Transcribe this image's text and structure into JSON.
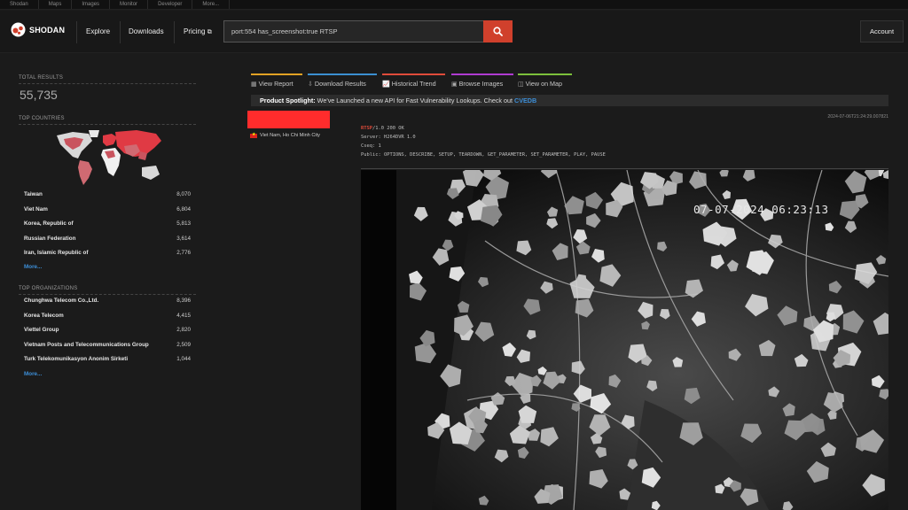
{
  "topbar": {
    "links": [
      "Shodan",
      "Maps",
      "Images",
      "Monitor",
      "Developer",
      "More..."
    ]
  },
  "nav": {
    "logo": "SHODAN",
    "explore": "Explore",
    "downloads": "Downloads",
    "pricing": "Pricing",
    "search_value": "port:554 has_screenshot:true RTSP",
    "account": "Account"
  },
  "sidebar": {
    "total_label": "TOTAL RESULTS",
    "total_value": "55,735",
    "countries_label": "TOP COUNTRIES",
    "countries": [
      {
        "name": "Taiwan",
        "count": "8,070"
      },
      {
        "name": "Viet Nam",
        "count": "6,804"
      },
      {
        "name": "Korea, Republic of",
        "count": "5,813"
      },
      {
        "name": "Russian Federation",
        "count": "3,614"
      },
      {
        "name": "Iran, Islamic Republic of",
        "count": "2,776"
      }
    ],
    "countries_more": "More...",
    "orgs_label": "TOP ORGANIZATIONS",
    "orgs": [
      {
        "name": "Chunghwa Telecom Co.,Ltd.",
        "count": "8,396"
      },
      {
        "name": "Korea Telecom",
        "count": "4,415"
      },
      {
        "name": "Viettel Group",
        "count": "2,820"
      },
      {
        "name": "Vietnam Posts and Telecommunications Group",
        "count": "2,509"
      },
      {
        "name": "Turk Telekomunikasyon Anonim Sirketi",
        "count": "1,044"
      }
    ],
    "orgs_more": "More..."
  },
  "tabs": [
    {
      "label": "View Report",
      "color": "#e2a224"
    },
    {
      "label": "Download Results",
      "color": "#3b8fd1"
    },
    {
      "label": "Historical Trend",
      "color": "#e04b3a"
    },
    {
      "label": "Browse Images",
      "color": "#b03bd1"
    },
    {
      "label": "View on Map",
      "color": "#7cc13b"
    }
  ],
  "spotlight": {
    "title": "Product Spotlight:",
    "text": " We've Launched a new API for Fast Vulnerability Lookups. Check out ",
    "link": "CVEDB"
  },
  "result": {
    "location": "Viet Nam, Ho Chi Minh City",
    "timestamp": "2024-07-06T21:24:29.007821",
    "banner_proto": "RTSP",
    "banner_status": "/1.0 200 OK",
    "banner_lines": [
      "Server: H264DVR 1.0",
      "Cseq: 1",
      "Public: OPTIONS, DESCRIBE, SETUP, TEARDOWN, GET_PARAMETER, SET_PARAMETER, PLAY, PAUSE"
    ],
    "osd_time": "07-07-2024 06:23:13"
  }
}
